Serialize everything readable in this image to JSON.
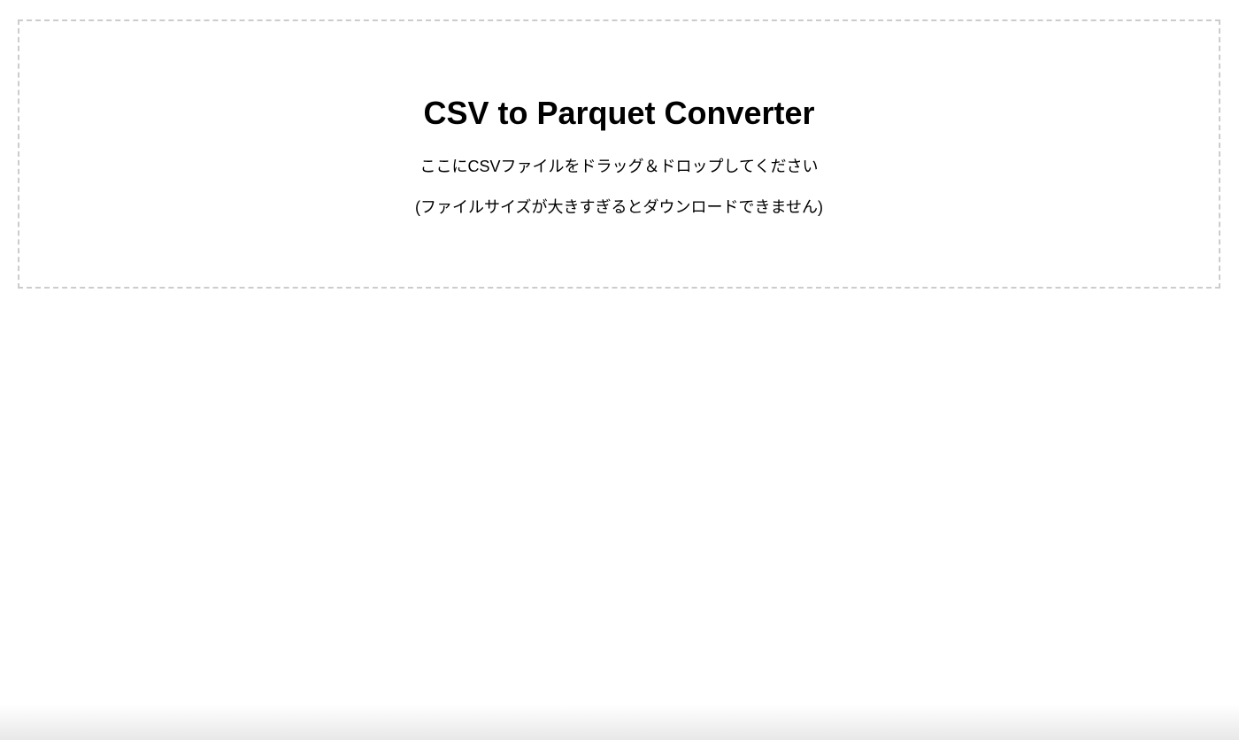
{
  "dropzone": {
    "title": "CSV to Parquet Converter",
    "instruction": "ここにCSVファイルをドラッグ＆ドロップしてください",
    "note": "(ファイルサイズが大きすぎるとダウンロードできません)"
  },
  "colors": {
    "background": "#ffffff",
    "border": "#cccccc",
    "text": "#000000"
  }
}
